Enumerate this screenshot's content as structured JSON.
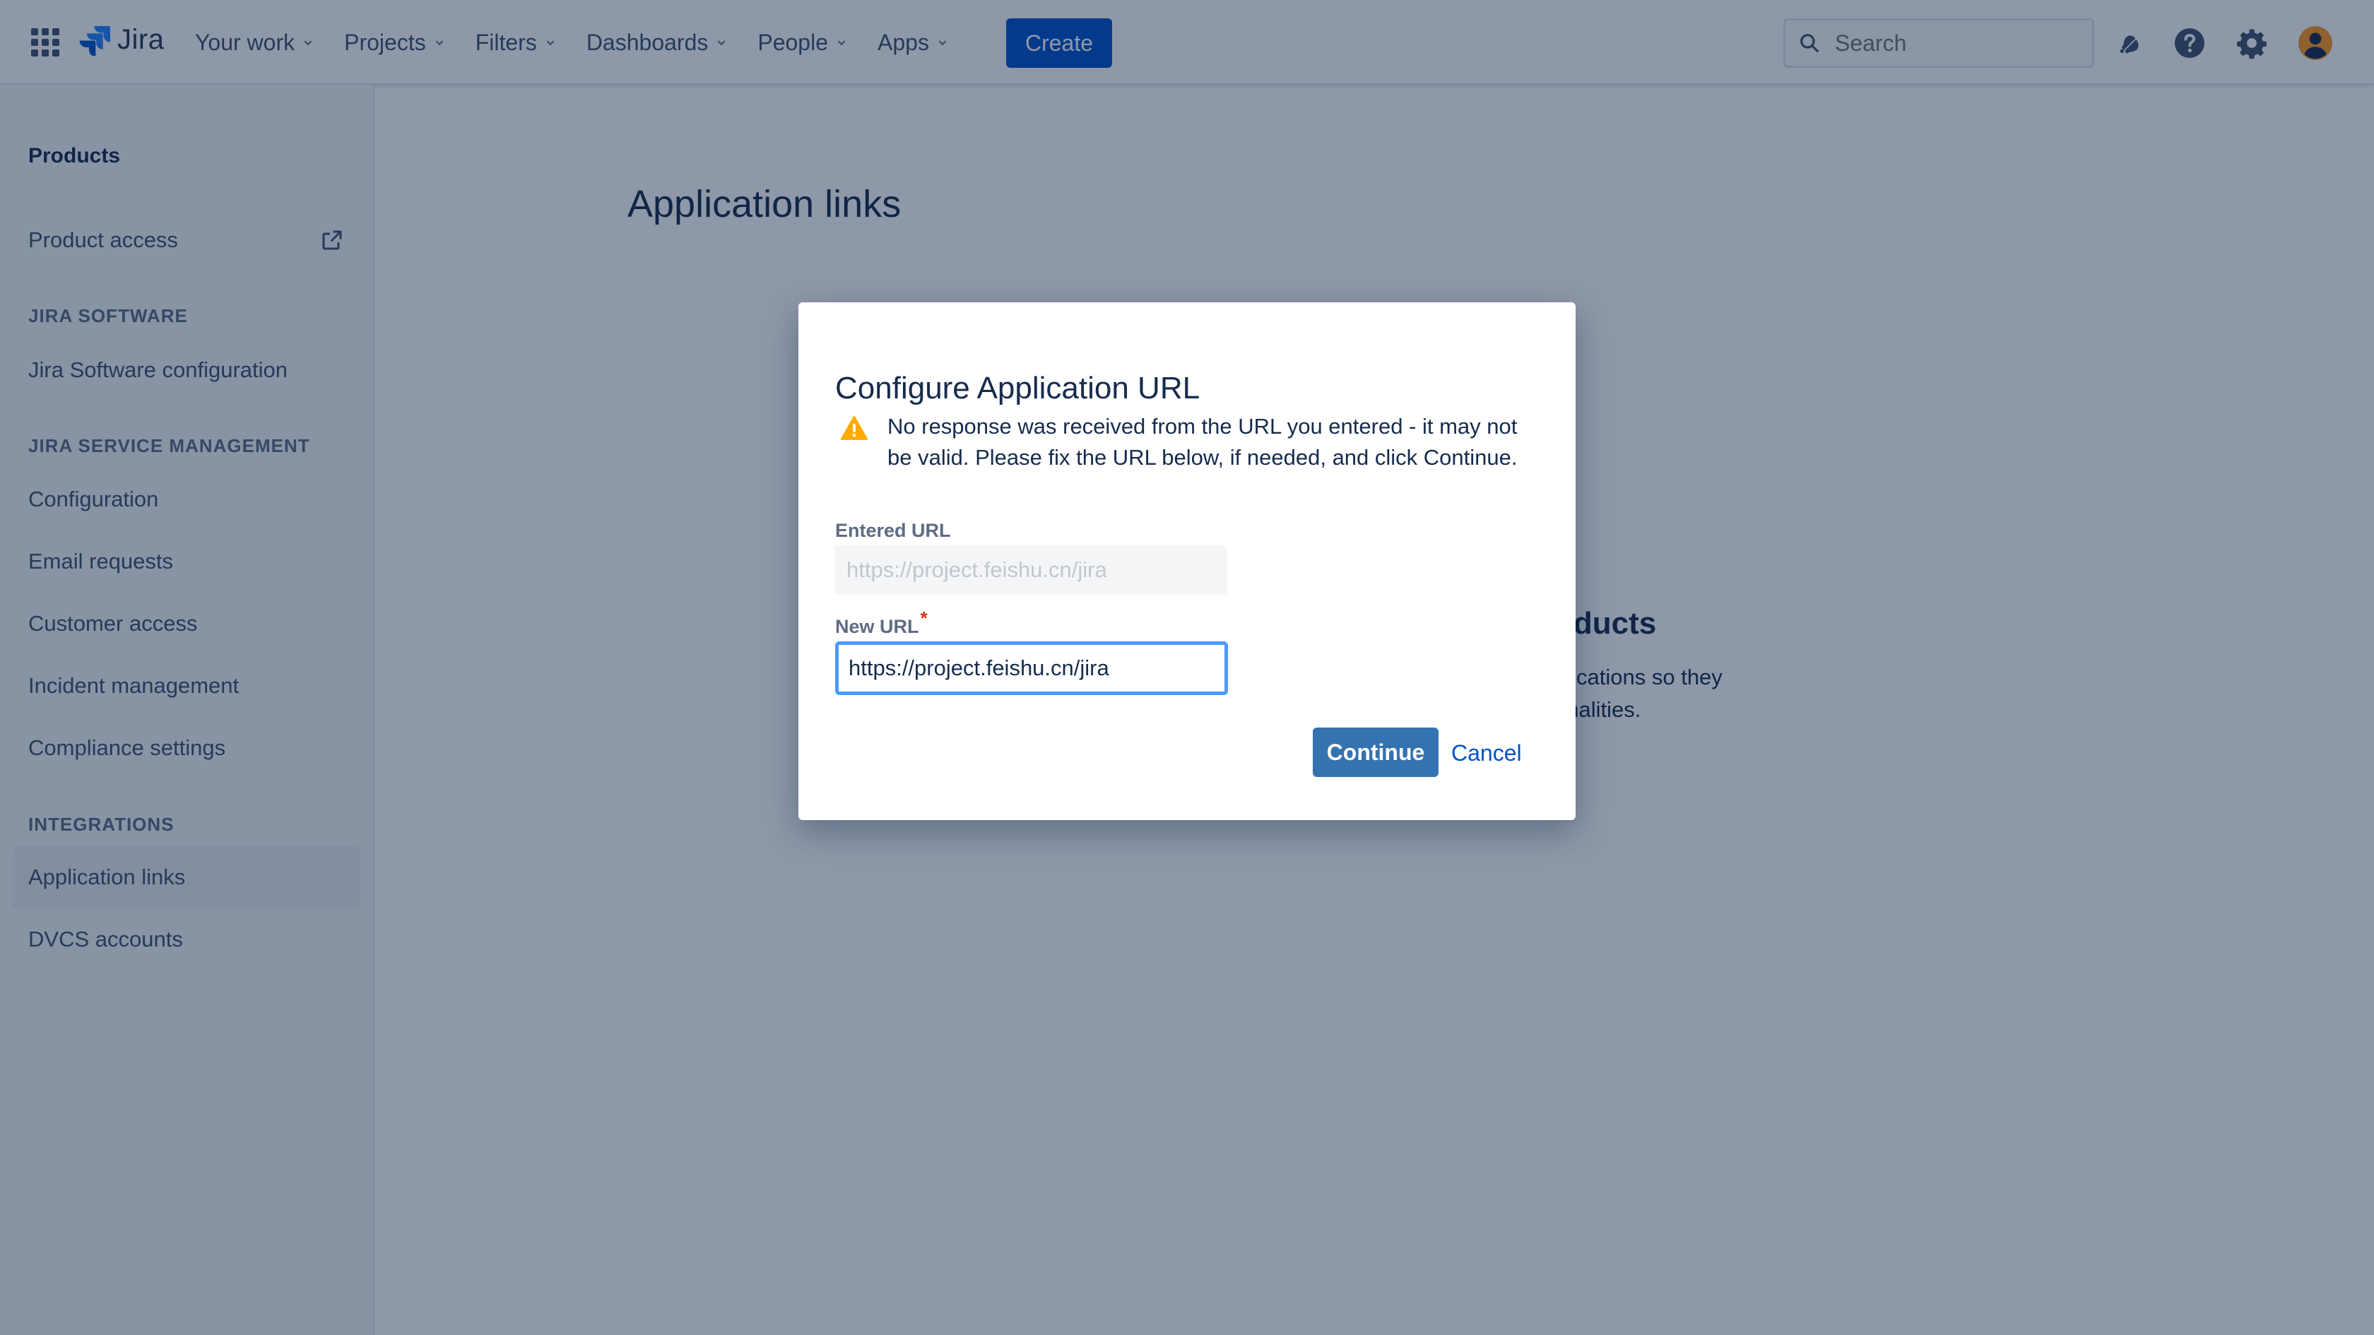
{
  "topnav": {
    "logo_text": "Jira",
    "items": [
      {
        "label": "Your work"
      },
      {
        "label": "Projects"
      },
      {
        "label": "Filters"
      },
      {
        "label": "Dashboards"
      },
      {
        "label": "People"
      },
      {
        "label": "Apps"
      }
    ],
    "create_label": "Create",
    "search_placeholder": "Search",
    "icons": [
      "app-switcher-icon",
      "jira-logo-icon",
      "notifications-icon",
      "help-icon",
      "settings-icon",
      "avatar"
    ]
  },
  "sidebar": {
    "heading": "Products",
    "product_access": "Product access",
    "section_jira_software": "JIRA SOFTWARE",
    "jira_software_configuration": "Jira Software configuration",
    "section_jsm": "JIRA SERVICE MANAGEMENT",
    "configuration": "Configuration",
    "email_requests": "Email requests",
    "customer_access": "Customer access",
    "incident_management": "Incident management",
    "compliance_settings": "Compliance settings",
    "section_integrations": "INTEGRATIONS",
    "application_links": "Application links",
    "dvcs_accounts": "DVCS accounts",
    "active_item": "Application links"
  },
  "main": {
    "title": "Application links",
    "partial_heading": "oducts",
    "partial_text_line1": "plications so they",
    "partial_text_line2": "onalities."
  },
  "dialog": {
    "title": "Configure Application URL",
    "warning": "No response was received from the URL you entered - it may not be valid. Please fix the URL below, if needed, and click Continue.",
    "entered_url_label": "Entered URL",
    "entered_url_value": "https://project.feishu.cn/jira",
    "new_url_label": "New URL",
    "required_mark": "*",
    "new_url_value": "https://project.feishu.cn/jira",
    "continue_label": "Continue",
    "cancel_label": "Cancel"
  },
  "colors": {
    "brand": "#0052CC",
    "continue_button": "#3572B0",
    "focus_ring": "#4C9AFF",
    "warning": "#FFAB00",
    "required": "#DE350B"
  }
}
